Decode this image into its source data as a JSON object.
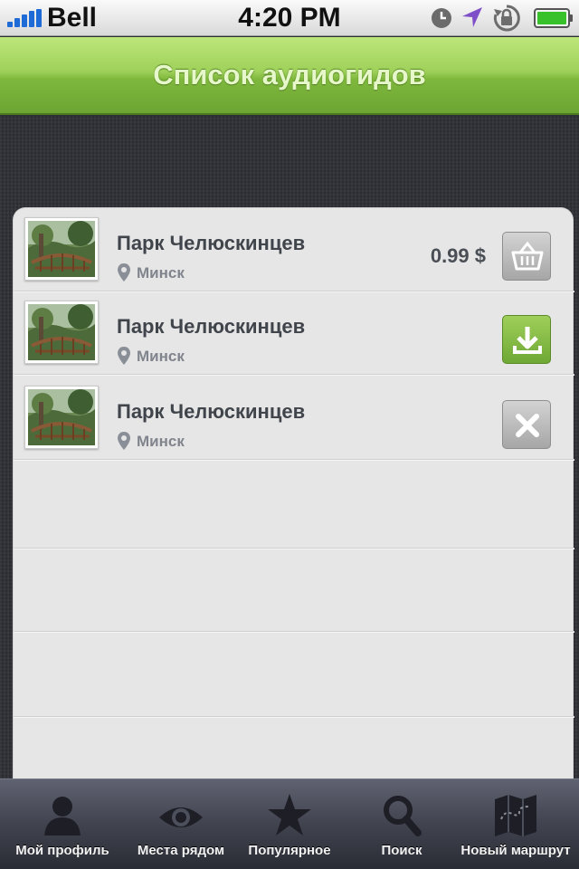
{
  "status_bar": {
    "carrier": "Bell",
    "time": "4:20 PM",
    "icons": [
      "signal-icon",
      "clock-icon",
      "location-arrow-icon",
      "rotation-lock-icon",
      "battery-icon"
    ]
  },
  "nav": {
    "title": "Список аудиогидов"
  },
  "guides": [
    {
      "title": "Парк Челюскинцев",
      "city": "Минск",
      "price": "0.99 $",
      "action": "basket-icon"
    },
    {
      "title": "Парк Челюскинцев",
      "city": "Минск",
      "price": "",
      "action": "download-icon"
    },
    {
      "title": "Парк Челюскинцев",
      "city": "Минск",
      "price": "",
      "action": "close-icon"
    }
  ],
  "tabs": [
    {
      "label": "Мой профиль",
      "icon": "profile-icon"
    },
    {
      "label": "Места рядом",
      "icon": "eye-icon"
    },
    {
      "label": "Популярное",
      "icon": "star-icon"
    },
    {
      "label": "Поиск",
      "icon": "search-icon"
    },
    {
      "label": "Новый маршрут",
      "icon": "map-icon"
    }
  ],
  "colors": {
    "nav_green": "#9fd15a",
    "download_green": "#7fb83d",
    "tab_bar": "#41434f"
  }
}
